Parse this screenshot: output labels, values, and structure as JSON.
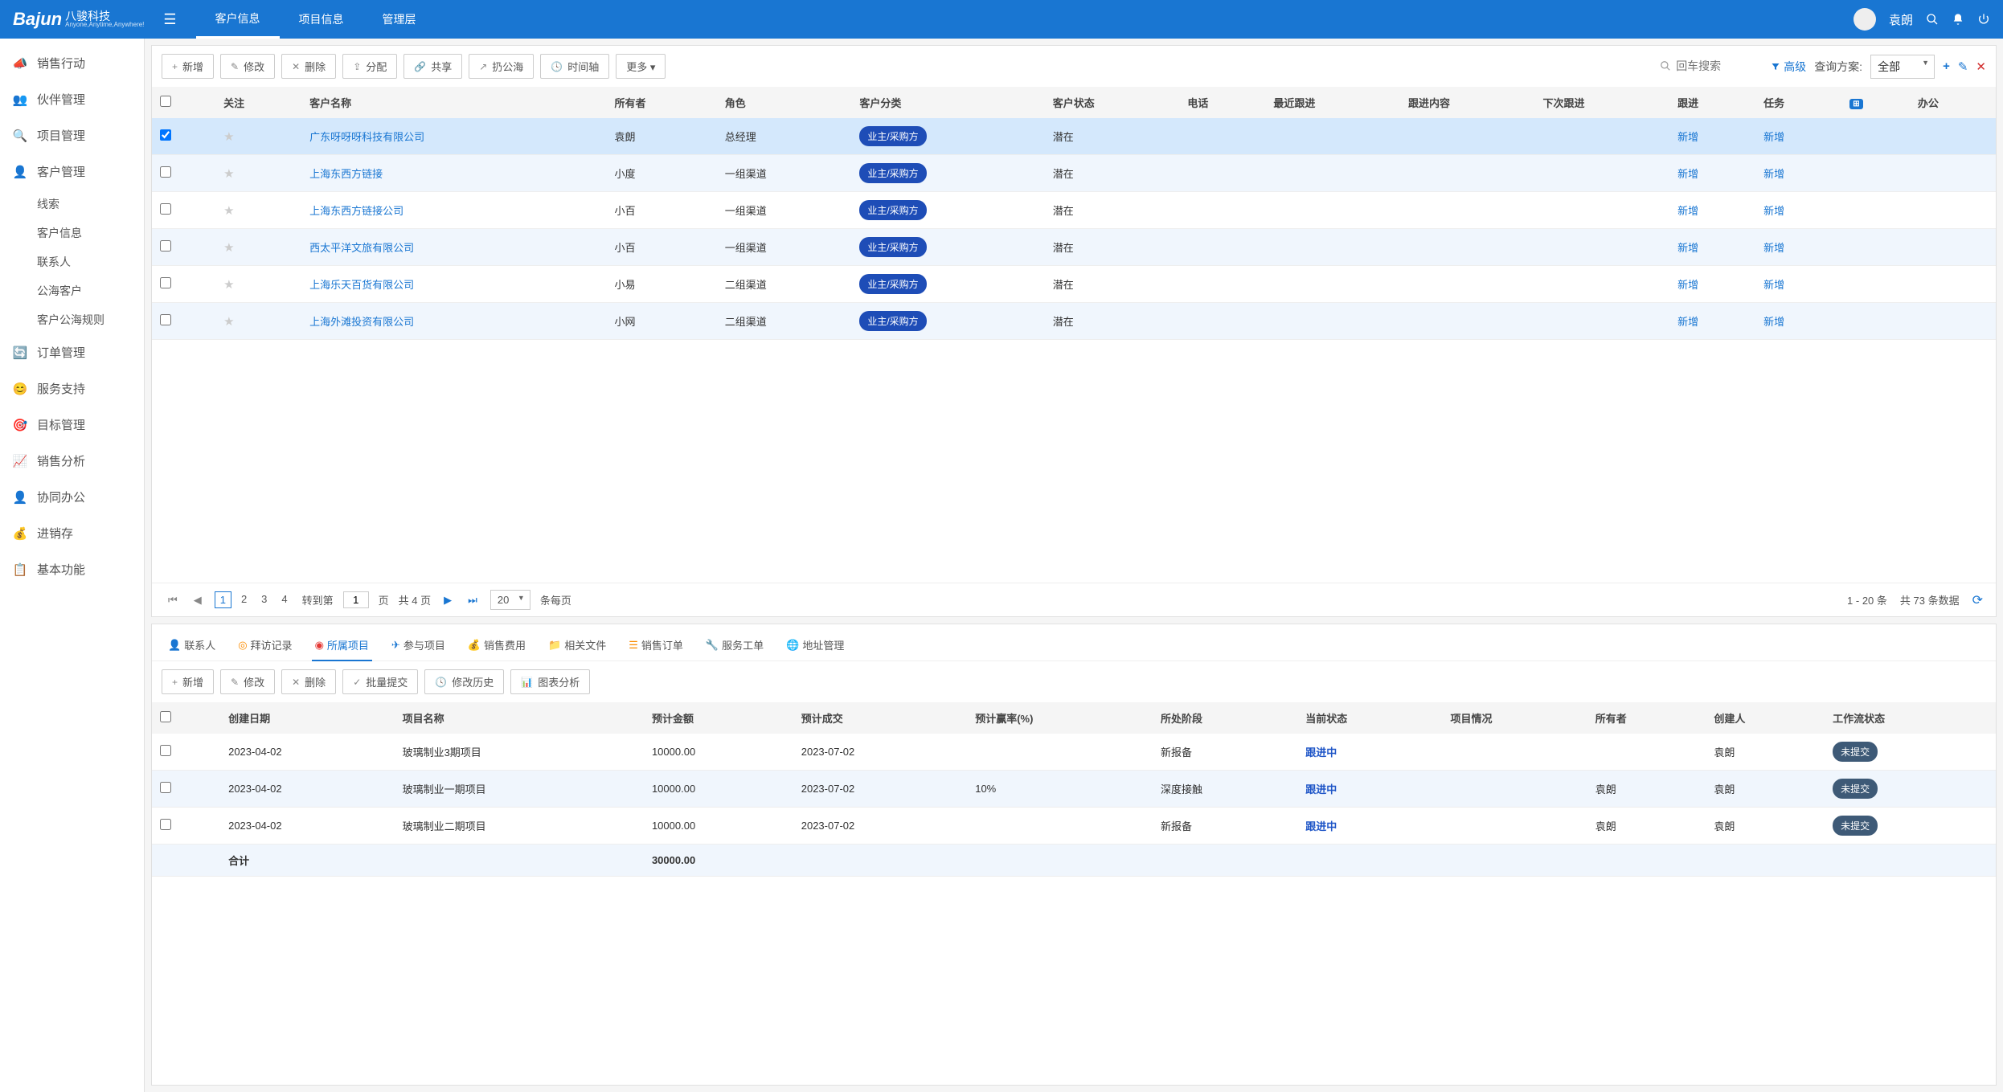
{
  "topbar": {
    "logo_main": "Bajun",
    "logo_cn": "八骏科技",
    "logo_en": "Anyone,Anytime,Anywhere!",
    "nav": [
      "客户信息",
      "项目信息",
      "管理层"
    ],
    "active_nav": 0,
    "username": "袁朗"
  },
  "sidebar": {
    "items": [
      {
        "icon": "📣",
        "label": "销售行动"
      },
      {
        "icon": "👥",
        "label": "伙伴管理"
      },
      {
        "icon": "🔍",
        "label": "项目管理"
      },
      {
        "icon": "👤",
        "label": "客户管理",
        "expanded": true,
        "children": [
          "线索",
          "客户信息",
          "联系人",
          "公海客户",
          "客户公海规则"
        ]
      },
      {
        "icon": "🔄",
        "label": "订单管理"
      },
      {
        "icon": "😊",
        "label": "服务支持"
      },
      {
        "icon": "🎯",
        "label": "目标管理"
      },
      {
        "icon": "📈",
        "label": "销售分析"
      },
      {
        "icon": "👤",
        "label": "协同办公"
      },
      {
        "icon": "💰",
        "label": "进销存"
      },
      {
        "icon": "📋",
        "label": "基本功能"
      }
    ]
  },
  "toolbar_top": {
    "buttons": [
      {
        "icon": "+",
        "label": "新增"
      },
      {
        "icon": "✎",
        "label": "修改"
      },
      {
        "icon": "✕",
        "label": "删除"
      },
      {
        "icon": "⇪",
        "label": "分配"
      },
      {
        "icon": "🔗",
        "label": "共享"
      },
      {
        "icon": "↗",
        "label": "扔公海"
      },
      {
        "icon": "🕓",
        "label": "时间轴"
      },
      {
        "icon": "",
        "label": "更多 ▾"
      }
    ],
    "search_placeholder": "回车搜索",
    "filter_label": "高级",
    "query_label": "查询方案:",
    "query_value": "全部"
  },
  "table": {
    "headers": [
      "",
      "关注",
      "客户名称",
      "所有者",
      "角色",
      "客户分类",
      "客户状态",
      "电话",
      "最近跟进",
      "跟进内容",
      "下次跟进",
      "跟进",
      "任务",
      "",
      "办公"
    ],
    "rows": [
      {
        "selected": true,
        "name": "广东呀呀呀科技有限公司",
        "owner": "袁朗",
        "role": "总经理",
        "cat": "业主/采购方",
        "status": "潜在",
        "follow": "新增",
        "task": "新增"
      },
      {
        "selected": false,
        "name": "上海东西方链接",
        "owner": "小度",
        "role": "一组渠道",
        "cat": "业主/采购方",
        "status": "潜在",
        "follow": "新增",
        "task": "新增"
      },
      {
        "selected": false,
        "name": "上海东西方链接公司",
        "owner": "小百",
        "role": "一组渠道",
        "cat": "业主/采购方",
        "status": "潜在",
        "follow": "新增",
        "task": "新增"
      },
      {
        "selected": false,
        "name": "西太平洋文旅有限公司",
        "owner": "小百",
        "role": "一组渠道",
        "cat": "业主/采购方",
        "status": "潜在",
        "follow": "新增",
        "task": "新增"
      },
      {
        "selected": false,
        "name": "上海乐天百货有限公司",
        "owner": "小易",
        "role": "二组渠道",
        "cat": "业主/采购方",
        "status": "潜在",
        "follow": "新增",
        "task": "新增"
      },
      {
        "selected": false,
        "name": "上海外滩投资有限公司",
        "owner": "小网",
        "role": "二组渠道",
        "cat": "业主/采购方",
        "status": "潜在",
        "follow": "新增",
        "task": "新增"
      }
    ]
  },
  "pagination": {
    "pages": [
      "1",
      "2",
      "3",
      "4"
    ],
    "current": 0,
    "goto_label": "转到第",
    "goto_value": "1",
    "page_text": "页",
    "total_pages": "共 4 页",
    "page_size": "20",
    "per_page": "条每页",
    "range": "1 - 20 条",
    "total": "共 73 条数据"
  },
  "bottom": {
    "tabs": [
      {
        "icon": "👤",
        "label": "联系人",
        "cls": "sticon-orange"
      },
      {
        "icon": "◎",
        "label": "拜访记录",
        "cls": "sticon-orange"
      },
      {
        "icon": "◉",
        "label": "所属项目",
        "cls": "sticon-red",
        "active": true
      },
      {
        "icon": "✈",
        "label": "参与项目",
        "cls": "sticon-blue"
      },
      {
        "icon": "💰",
        "label": "销售费用",
        "cls": "sticon-orange"
      },
      {
        "icon": "📁",
        "label": "相关文件",
        "cls": "sticon-yellow"
      },
      {
        "icon": "☰",
        "label": "销售订单",
        "cls": "sticon-orange"
      },
      {
        "icon": "🔧",
        "label": "服务工单",
        "cls": "sticon-red"
      },
      {
        "icon": "🌐",
        "label": "地址管理",
        "cls": "sticon-green"
      }
    ],
    "toolbar": [
      {
        "icon": "+",
        "label": "新增"
      },
      {
        "icon": "✎",
        "label": "修改"
      },
      {
        "icon": "✕",
        "label": "删除"
      },
      {
        "icon": "✓",
        "label": "批量提交"
      },
      {
        "icon": "🕓",
        "label": "修改历史"
      },
      {
        "icon": "📊",
        "label": "图表分析"
      }
    ],
    "headers": [
      "",
      "创建日期",
      "项目名称",
      "预计金额",
      "预计成交",
      "预计赢率(%)",
      "所处阶段",
      "当前状态",
      "项目情况",
      "所有者",
      "创建人",
      "工作流状态"
    ],
    "rows": [
      {
        "date": "2023-04-02",
        "name": "玻璃制业3期项目",
        "amount": "10000.00",
        "close": "2023-07-02",
        "rate": "",
        "stage": "新报备",
        "status": "跟进中",
        "owner": "",
        "creator": "袁朗",
        "wf": "未提交"
      },
      {
        "date": "2023-04-02",
        "name": "玻璃制业一期项目",
        "amount": "10000.00",
        "close": "2023-07-02",
        "rate": "10%",
        "stage": "深度接触",
        "status": "跟进中",
        "owner": "袁朗",
        "creator": "袁朗",
        "wf": "未提交"
      },
      {
        "date": "2023-04-02",
        "name": "玻璃制业二期项目",
        "amount": "10000.00",
        "close": "2023-07-02",
        "rate": "",
        "stage": "新报备",
        "status": "跟进中",
        "owner": "袁朗",
        "creator": "袁朗",
        "wf": "未提交"
      }
    ],
    "sum_label": "合计",
    "sum_amount": "30000.00"
  }
}
